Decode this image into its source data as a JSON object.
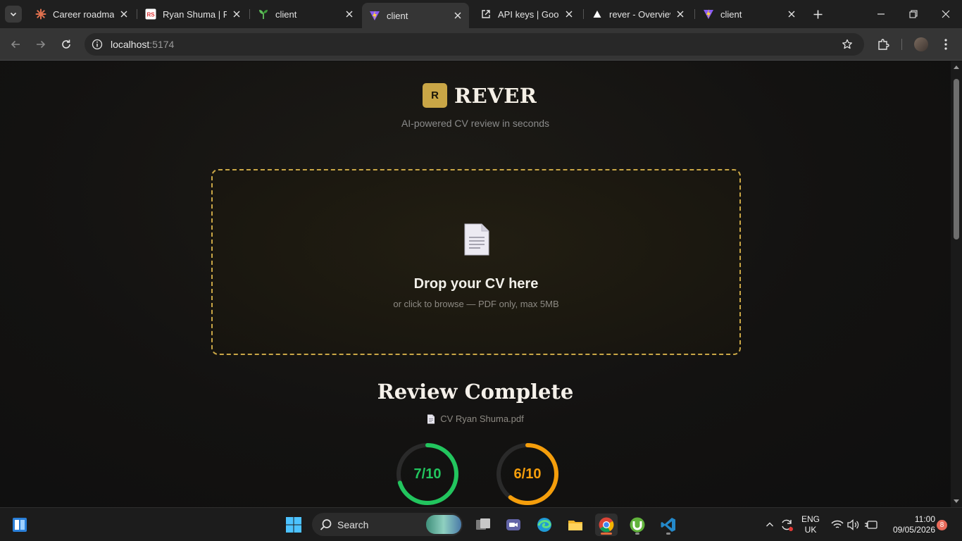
{
  "browser": {
    "tabs": [
      {
        "title": "Career roadmap",
        "favicon": "asterisk-icon"
      },
      {
        "title": "Ryan Shuma | Fu",
        "favicon": "rs-logo-icon"
      },
      {
        "title": "client",
        "favicon": "sprout-icon"
      },
      {
        "title": "client",
        "favicon": "vite-bolt-icon",
        "active": true
      },
      {
        "title": "API keys | Googl",
        "favicon": "external-link-icon"
      },
      {
        "title": "rever - Overview",
        "favicon": "vercel-triangle-icon"
      },
      {
        "title": "client",
        "favicon": "vite-bolt-icon"
      }
    ],
    "url_host": "localhost",
    "url_port": ":5174"
  },
  "app": {
    "logo_letter": "R",
    "name": "REVER",
    "tagline": "AI-powered CV review in seconds",
    "accent_color": "#c9a646"
  },
  "dropzone": {
    "title": "Drop your CV here",
    "subtitle": "or click to browse — PDF only, max 5MB"
  },
  "review": {
    "title": "Review Complete",
    "file_name": "CV Ryan Shuma.pdf",
    "scores": [
      {
        "label": "7/10",
        "value": 7,
        "max": 10,
        "color": "#22c55e"
      },
      {
        "label": "6/10",
        "value": 6,
        "max": 10,
        "color": "#f59e0b"
      }
    ]
  },
  "taskbar": {
    "search_label": "Search",
    "language_line1": "ENG",
    "language_line2": "UK",
    "time": "11:00",
    "date": "09/05/2026",
    "notification_count": "8"
  }
}
